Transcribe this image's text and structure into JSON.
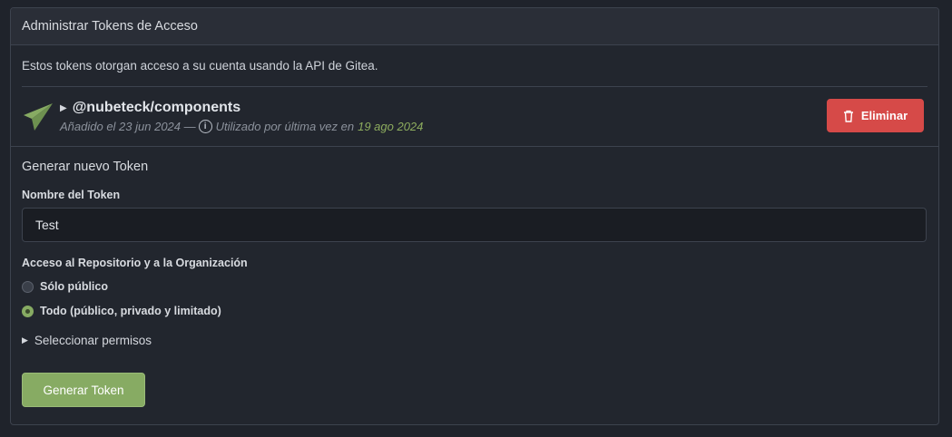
{
  "header": {
    "title": "Administrar Tokens de Acceso"
  },
  "intro": {
    "text": "Estos tokens otorgan acceso a su cuenta usando la API de Gitea."
  },
  "token": {
    "name": "@nubeteck/components",
    "added": "Añadido el 23 jun 2024 —",
    "last_used_prefix": "Utilizado por última vez en",
    "last_used_date": "19 ago 2024",
    "delete_label": "Eliminar",
    "icon": "paper-plane-icon"
  },
  "generate": {
    "title": "Generar nuevo Token",
    "name_label": "Nombre del Token",
    "name_value": "Test",
    "access_label": "Acceso al Repositorio y a la Organización",
    "options": [
      {
        "label": "Sólo público",
        "checked": false
      },
      {
        "label": "Todo (público, privado y limitado)",
        "checked": true
      }
    ],
    "permissions_label": "Seleccionar permisos",
    "submit_label": "Generar Token"
  },
  "colors": {
    "accent": "#87ab63",
    "danger": "#d64a48",
    "background": "#22262e"
  }
}
